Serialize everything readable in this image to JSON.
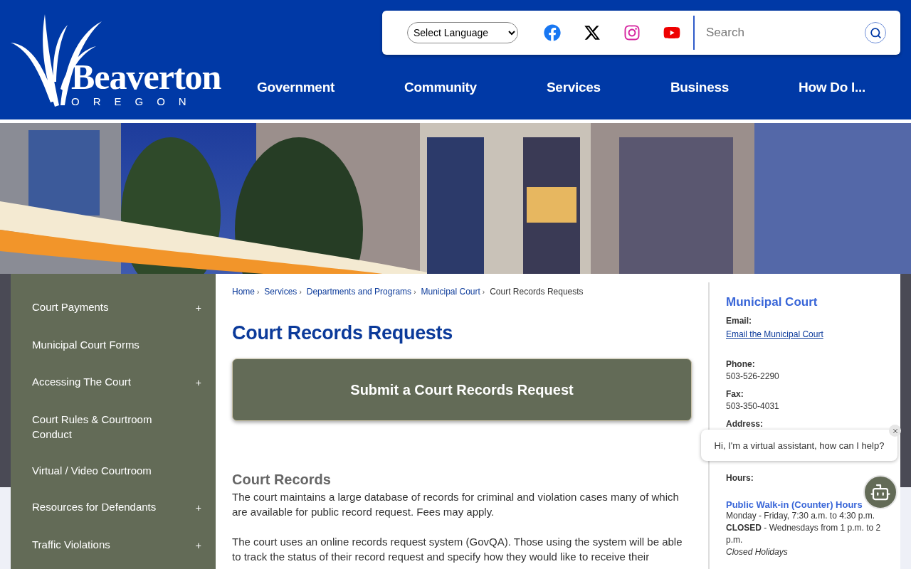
{
  "header": {
    "logo": {
      "name": "Beaverton",
      "subtitle": "OREGON"
    },
    "language_select": {
      "value": "Select Language"
    },
    "social_links": [
      {
        "kind": "facebook"
      },
      {
        "kind": "x"
      },
      {
        "kind": "instagram"
      },
      {
        "kind": "youtube"
      }
    ],
    "search": {
      "placeholder": "Search"
    },
    "nav": [
      "Government",
      "Community",
      "Services",
      "Business",
      "How Do I..."
    ]
  },
  "sidebar": {
    "items": [
      {
        "label": "Court Payments",
        "toggle": "+"
      },
      {
        "label": "Municipal Court Forms"
      },
      {
        "label": "Accessing The Court",
        "toggle": "+"
      },
      {
        "label": "Court Rules & Courtroom Conduct"
      },
      {
        "label": "Virtual / Video Courtroom"
      },
      {
        "label": "Resources for Defendants",
        "toggle": "+"
      },
      {
        "label": "Traffic Violations",
        "toggle": "+"
      }
    ]
  },
  "breadcrumbs": [
    {
      "label": "Home",
      "link": true,
      "separator": "›"
    },
    {
      "label": "Services",
      "link": true,
      "separator": "›"
    },
    {
      "label": "Departments and Programs",
      "link": true,
      "separator": "›"
    },
    {
      "label": "Municipal Court",
      "link": true,
      "separator": "›"
    },
    {
      "label": "Court Records Requests",
      "link": false
    }
  ],
  "page_title": "Court Records Requests",
  "cta_button": "Submit a Court Records Request",
  "section": {
    "heading": "Court Records",
    "paragraphs": [
      "The court maintains a large database of records for criminal and violation cases many of which are available for public record request. Fees may apply.",
      "The court uses an online records request system (GovQA). Those using the system will be able to track the status of their record request and specify how they would like to receive their"
    ]
  },
  "contact": {
    "heading": "Municipal Court",
    "fields": [
      {
        "label": "Email:",
        "kind": "link",
        "value": "Email the Municipal Court"
      },
      {
        "label": "Phone:",
        "kind": "text",
        "value": "503-526-2290"
      },
      {
        "label": "Fax:",
        "kind": "text",
        "value": "503-350-4031"
      },
      {
        "label": "Address:",
        "kind": "empty"
      },
      {
        "label": "Hours:",
        "kind": "empty"
      }
    ],
    "hours": {
      "heading": "Public Walk-in (Counter) Hours",
      "lines": [
        {
          "kind": "plain",
          "text": "Monday - Friday, 7:30 a.m. to 4:30 p.m."
        },
        {
          "kind": "plain",
          "text": "**CLOSED** - Wednesdays from 1 p.m. to 2 p.m."
        },
        {
          "kind": "italic",
          "text": "Closed Holidays"
        }
      ]
    }
  },
  "chat": {
    "message": "Hi, I'm a virtual assistant, how can I help?"
  }
}
